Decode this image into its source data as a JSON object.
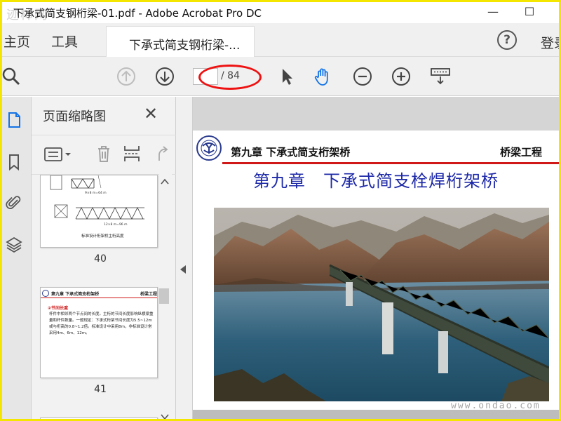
{
  "window": {
    "title": "下承式简支钢桁梁-01.pdf - Adobe Acrobat Pro DC",
    "watermark": "迹柿网",
    "minimize": "—",
    "maximize": "☐"
  },
  "tabs": {
    "home": "主页",
    "tools": "工具",
    "document": "下承式简支钢桁梁-...",
    "login": "登录"
  },
  "toolbar": {
    "page_current": "",
    "page_total": "/ 84"
  },
  "panel": {
    "title": "页面缩略图",
    "thumbnails": [
      {
        "page": "40",
        "caption": "标准设计桁架桥主桁高度",
        "label_a": "9×8 m=64 m",
        "label_b": "12×8 m=96 m"
      },
      {
        "page": "41",
        "header_left": "第九章 下承式简支桁架桥",
        "header_right": "桥梁工程",
        "heading": "②节间长度",
        "body": "杆件中相邻两个节点间的长度。主桁的节间长度影响纵横梁重量和杆件数量。一般规定：下承式桁架节间长度为5.5~12m或与桁高的0.8~1.2倍。标准设计中采用8m，非标准设计常采用4m、6m、12m。"
      }
    ]
  },
  "document": {
    "header_left": "第九章 下承式简支桁架桥",
    "header_right": "桥梁工程",
    "chapter_title": "第九章　下承式简支栓焊桁架桥"
  },
  "watermark_bottom": "www.ondao.com",
  "colors": {
    "title_blue": "#1e2aa8",
    "rule_red": "#d01818",
    "annotation_red": "#ee1111",
    "acrobat_blue": "#1473e6"
  }
}
